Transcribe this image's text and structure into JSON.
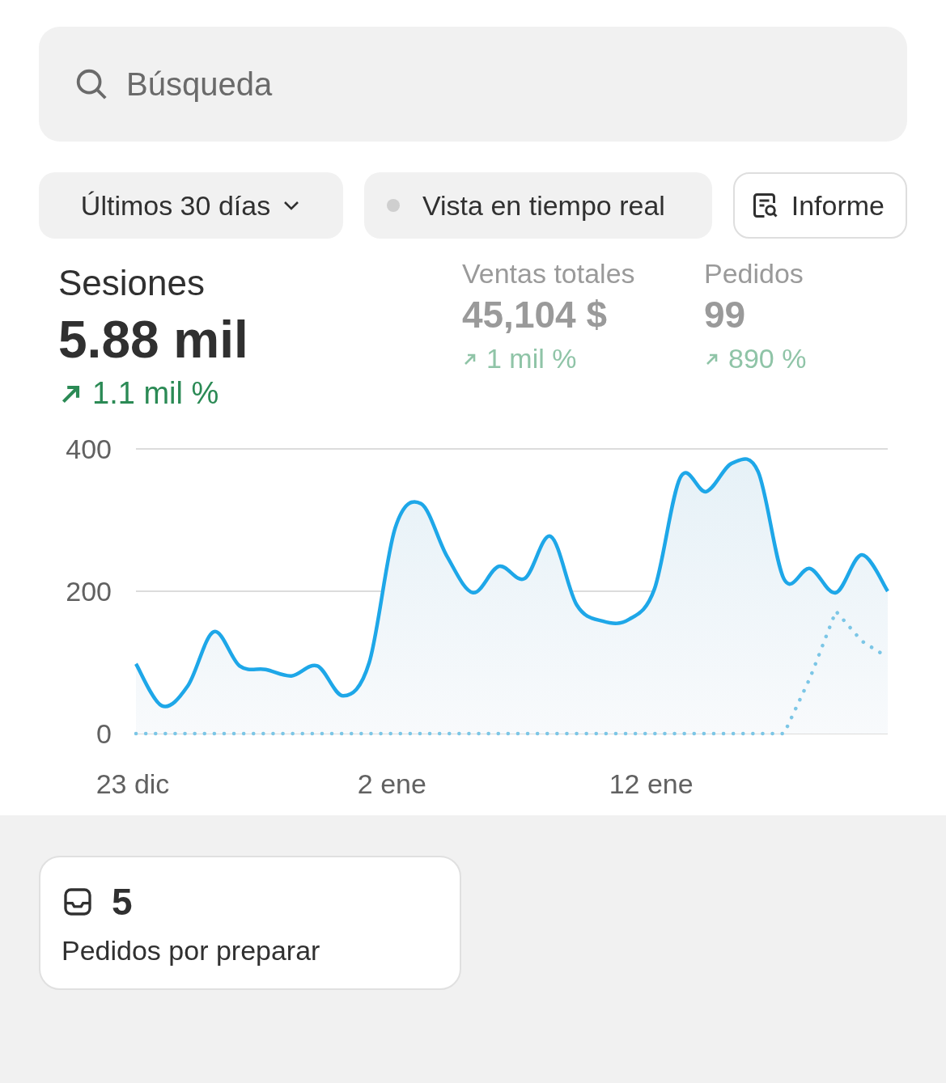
{
  "search": {
    "placeholder": "Búsqueda"
  },
  "filters": [
    {
      "kind": "dropdown",
      "label": "Últimos 30 días"
    },
    {
      "kind": "live",
      "label": "Vista en tiempo real",
      "active": false
    },
    {
      "kind": "report",
      "label": "Informe"
    }
  ],
  "metrics": [
    {
      "label": "Sesiones",
      "value": "5.88 mil",
      "change": "1.1 mil %",
      "selected": true
    },
    {
      "label": "Ventas totales",
      "value": "45,104 $",
      "change": "1 mil %",
      "selected": false
    },
    {
      "label": "Pedidos",
      "value": "99",
      "change": "890 %",
      "selected": false
    }
  ],
  "chart_data": {
    "type": "area",
    "categories": [
      "23 dic",
      null,
      null,
      null,
      null,
      null,
      null,
      null,
      null,
      null,
      "2 ene",
      null,
      null,
      null,
      null,
      null,
      null,
      null,
      null,
      null,
      "12 ene",
      null,
      null,
      null,
      null,
      null,
      null,
      null,
      null,
      null
    ],
    "series": [
      {
        "color": "#1ea7e8",
        "values": [
          98,
          39,
          67,
          143,
          95,
          90,
          81,
          95,
          53,
          100,
          289,
          323,
          249,
          198,
          235,
          218,
          277,
          181,
          158,
          160,
          203,
          360,
          340,
          380,
          368,
          217,
          232,
          198,
          251,
          200
        ]
      },
      {
        "color": "#7cc6e6",
        "type": "line",
        "line_style": "dotted",
        "values": [
          0,
          0,
          0,
          0,
          0,
          0,
          0,
          0,
          0,
          0,
          0,
          0,
          0,
          0,
          0,
          0,
          0,
          0,
          0,
          0,
          0,
          0,
          0,
          0,
          0,
          0,
          78,
          172,
          130,
          107
        ]
      }
    ],
    "ylim": [
      0,
      400
    ],
    "yticks": [
      0,
      200,
      400
    ]
  },
  "tasks": [
    {
      "count": "5",
      "label": "Pedidos por preparar"
    }
  ]
}
